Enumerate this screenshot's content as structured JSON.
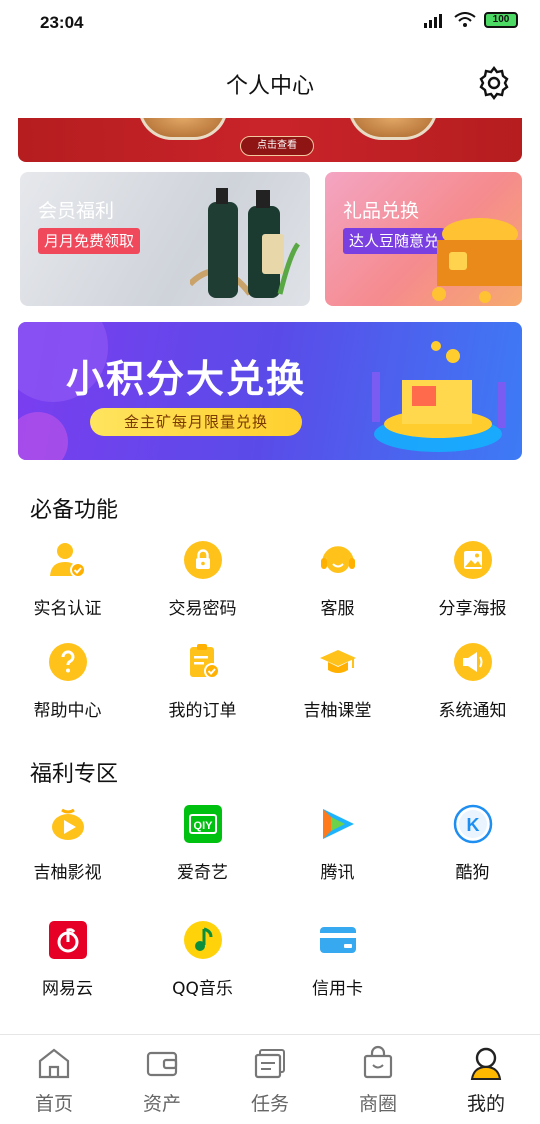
{
  "status": {
    "time": "23:04",
    "battery": "100"
  },
  "header": {
    "title": "个人中心"
  },
  "banner": {
    "button_label": "点击查看"
  },
  "cards": {
    "member": {
      "title": "会员福利",
      "subtitle": "月月免费领取"
    },
    "gift": {
      "title": "礼品兑换",
      "subtitle": "达人豆随意兑"
    }
  },
  "promo": {
    "title": "小积分大兑换",
    "subtitle": "金主矿每月限量兑换"
  },
  "essentials": {
    "title": "必备功能",
    "items": [
      {
        "label": "实名认证",
        "icon": "user-verified-icon"
      },
      {
        "label": "交易密码",
        "icon": "lock-icon"
      },
      {
        "label": "客服",
        "icon": "headset-icon"
      },
      {
        "label": "分享海报",
        "icon": "image-icon"
      },
      {
        "label": "帮助中心",
        "icon": "help-icon"
      },
      {
        "label": "我的订单",
        "icon": "clipboard-icon"
      },
      {
        "label": "吉柚课堂",
        "icon": "graduation-cap-icon"
      },
      {
        "label": "系统通知",
        "icon": "megaphone-icon"
      }
    ]
  },
  "welfare": {
    "title": "福利专区",
    "items": [
      {
        "label": "吉柚影视",
        "icon": "play-video-icon"
      },
      {
        "label": "爱奇艺",
        "icon": "iqiyi-icon"
      },
      {
        "label": "腾讯",
        "icon": "tencent-video-icon"
      },
      {
        "label": "酷狗",
        "icon": "kugou-icon"
      },
      {
        "label": "网易云",
        "icon": "netease-music-icon"
      },
      {
        "label": "QQ音乐",
        "icon": "qq-music-icon"
      },
      {
        "label": "信用卡",
        "icon": "credit-card-icon"
      }
    ]
  },
  "tabbar": {
    "items": [
      {
        "label": "首页",
        "icon": "home-icon"
      },
      {
        "label": "资产",
        "icon": "wallet-icon"
      },
      {
        "label": "任务",
        "icon": "tasks-icon"
      },
      {
        "label": "商圈",
        "icon": "shopping-bag-icon"
      },
      {
        "label": "我的",
        "icon": "profile-icon"
      }
    ],
    "active_index": 4
  },
  "colors": {
    "accent": "#ffb800",
    "icon_yellow": "#ffc21a"
  }
}
